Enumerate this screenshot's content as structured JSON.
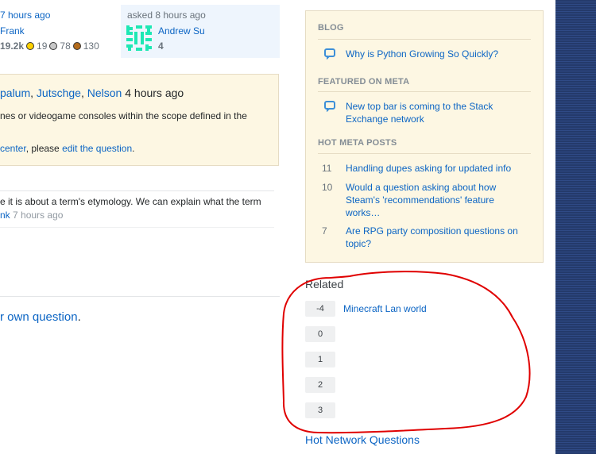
{
  "editor": {
    "time": "7 hours ago",
    "name": "Frank",
    "reputation": "19.2k",
    "badges": {
      "gold": "19",
      "silver": "78",
      "bronze": "130"
    }
  },
  "asker": {
    "asked_label": "asked 8 hours ago",
    "name": "Andrew Su",
    "reputation": "4"
  },
  "notice": {
    "closers": [
      "palum",
      "Jutschge",
      "Nelson"
    ],
    "closers_sep": ", ",
    "time": "4 hours ago",
    "line1": "nes or videogame consoles within the scope defined in the",
    "line2_link1": "center",
    "line2_mid": ", please ",
    "line2_link2": "edit the question",
    "line2_end": "."
  },
  "comment": {
    "text": "e it is about a term's etymology. We can explain what the term",
    "author": "nk",
    "time": "7 hours ago"
  },
  "own_question_link": "r own question",
  "own_question_end": ".",
  "sidebar": {
    "blog": {
      "heading": "BLOG",
      "items": [
        {
          "icon": "chat-bubble-icon",
          "label": "Why is Python Growing So Quickly?"
        }
      ]
    },
    "featured": {
      "heading": "FEATURED ON META",
      "items": [
        {
          "icon": "chat-bubble-icon",
          "label": "New top bar is coming to the Stack Exchange network"
        }
      ]
    },
    "hot_meta": {
      "heading": "HOT META POSTS",
      "items": [
        {
          "score": "11",
          "label": "Handling dupes asking for updated info"
        },
        {
          "score": "10",
          "label": "Would a question asking about how Steam's 'recommendations' feature works…"
        },
        {
          "score": "7",
          "label": "Are RPG party composition questions on topic?"
        }
      ]
    }
  },
  "related": {
    "heading": "Related",
    "items": [
      {
        "score": "-4",
        "title": "Minecraft Lan world"
      },
      {
        "score": "0",
        "title": ""
      },
      {
        "score": "1",
        "title": ""
      },
      {
        "score": "2",
        "title": ""
      },
      {
        "score": "3",
        "title": ""
      }
    ]
  },
  "hot_network": "Hot Network Questions",
  "colors": {
    "link": "#0c65c4",
    "notice_bg": "#fdf7e3",
    "asker_bg": "#eef5fd",
    "annotation": "#e00000",
    "stripe": "#243a6b"
  }
}
